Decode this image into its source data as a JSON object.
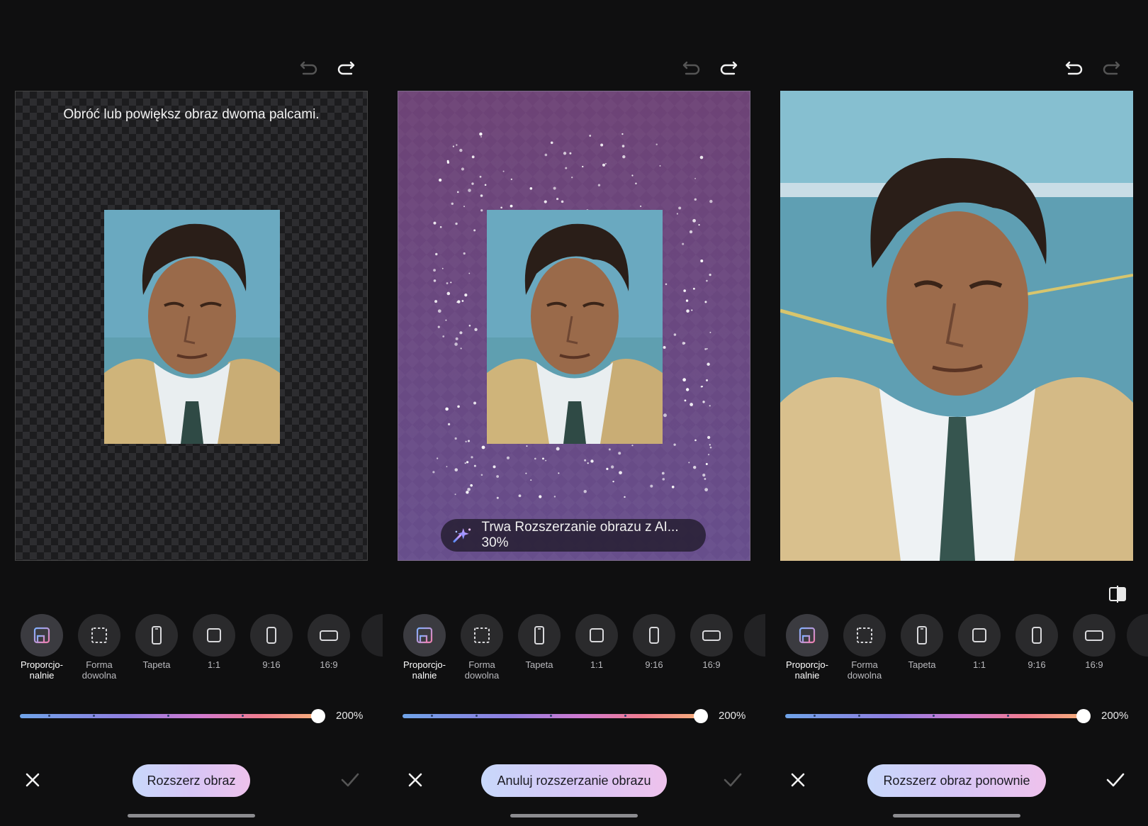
{
  "screens": [
    {
      "hint": "Obróć lub powiększ obraz dwoma palcami.",
      "action_label": "Rozszerz obraz",
      "undo_enabled": false,
      "redo_enabled": true,
      "confirm_enabled": false
    },
    {
      "progress_text": "Trwa Rozszerzanie obrazu z AI... 30%",
      "action_label": "Anuluj rozszerzanie obrazu",
      "undo_enabled": false,
      "redo_enabled": true,
      "confirm_enabled": false
    },
    {
      "action_label": "Rozszerz obraz ponownie",
      "undo_enabled": true,
      "redo_enabled": false,
      "confirm_enabled": true
    }
  ],
  "ratios": [
    {
      "id": "proportional",
      "label": "Proporcjo-\nnalnie",
      "icon": "proportional-icon",
      "active": true
    },
    {
      "id": "freeform",
      "label": "Forma\ndowolna",
      "icon": "freeform-icon"
    },
    {
      "id": "wallpaper",
      "label": "Tapeta",
      "icon": "phone-icon"
    },
    {
      "id": "1-1",
      "label": "1:1",
      "icon": "square-icon"
    },
    {
      "id": "9-16",
      "label": "9:16",
      "icon": "portrait-icon"
    },
    {
      "id": "16-9",
      "label": "16:9",
      "icon": "landscape-icon"
    }
  ],
  "zoom": {
    "value": 1.0,
    "label": "200%"
  },
  "colors": {
    "background": "#0f0f10",
    "accent_gradient_start": "#c8d8fb",
    "accent_gradient_end": "#eec2ec",
    "generating_overlay": "#6a4b7f"
  }
}
